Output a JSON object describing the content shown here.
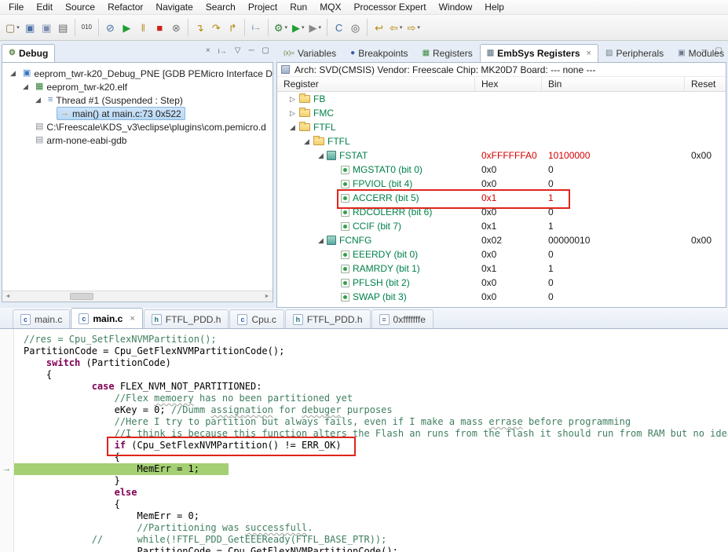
{
  "colors": {
    "annotation_red": "#e0241c",
    "changed_value_red": "#d40000",
    "register_name_green": "#00804a",
    "comment_green": "#3f7f5f",
    "keyword_purple": "#7f0055",
    "current_line_green": "#a4cf73",
    "selection_blue": "#cfe4fa"
  },
  "menu_bar": {
    "items": [
      "File",
      "Edit",
      "Source",
      "Refactor",
      "Navigate",
      "Search",
      "Project",
      "Run",
      "MQX",
      "Processor Expert",
      "Window",
      "Help"
    ]
  },
  "toolbar": {
    "items": [
      {
        "name": "new-wizard",
        "glyph": "▢",
        "color": "#8a7340",
        "dropdown": true
      },
      {
        "name": "save",
        "glyph": "▣",
        "color": "#4a6fa5"
      },
      {
        "name": "save-all",
        "glyph": "▣",
        "color": "#7a8db0"
      },
      {
        "name": "print",
        "glyph": "▤",
        "color": "#666666"
      },
      {
        "sep": true
      },
      {
        "name": "debug-binary",
        "glyph": "010",
        "color": "#333333"
      },
      {
        "sep": true
      },
      {
        "name": "skip-all-breakpoints",
        "glyph": "⊘",
        "color": "#3a6ea5"
      },
      {
        "name": "resume",
        "glyph": "▶",
        "color": "#1e9e33"
      },
      {
        "name": "suspend",
        "glyph": "‖",
        "color": "#b98f2f"
      },
      {
        "name": "terminate",
        "glyph": "■",
        "color": "#cf2219"
      },
      {
        "name": "disconnect",
        "glyph": "⊗",
        "color": "#777777"
      },
      {
        "sep": true
      },
      {
        "name": "step-into",
        "glyph": "↴",
        "color": "#b8860b"
      },
      {
        "name": "step-over",
        "glyph": "↷",
        "color": "#b8860b"
      },
      {
        "name": "step-return",
        "glyph": "↱",
        "color": "#b8860b"
      },
      {
        "sep": true
      },
      {
        "name": "instruction-stepping",
        "glyph": "i→",
        "color": "#3a6ea5"
      },
      {
        "sep": true
      },
      {
        "name": "debug",
        "glyph": "⚙",
        "color": "#2e7d32",
        "dropdown": true
      },
      {
        "name": "run",
        "glyph": "▶",
        "color": "#1e9e33",
        "dropdown": true
      },
      {
        "name": "external-tools",
        "glyph": "▶",
        "color": "#888888",
        "dropdown": true
      },
      {
        "sep": true
      },
      {
        "name": "new-c-project",
        "glyph": "C",
        "color": "#3a6ea5"
      },
      {
        "name": "search",
        "glyph": "◎",
        "color": "#555555"
      },
      {
        "sep": true
      },
      {
        "name": "last-edit-location",
        "glyph": "↩",
        "color": "#b8860b"
      },
      {
        "name": "back",
        "glyph": "⇦",
        "color": "#b8860b",
        "dropdown": true
      },
      {
        "name": "forward",
        "glyph": "⇨",
        "color": "#b8860b",
        "dropdown": true
      }
    ]
  },
  "debug_panel": {
    "tab_label": "Debug",
    "toolbar": [
      {
        "name": "remove-all-terminated",
        "glyph": "×"
      },
      {
        "name": "instruction-stepping-mode",
        "glyph": "i→"
      },
      {
        "name": "view-menu",
        "glyph": "▽"
      },
      {
        "name": "minimize",
        "glyph": "─"
      },
      {
        "name": "maximize",
        "glyph": "▢"
      }
    ],
    "tree": [
      {
        "label": "eeprom_twr-k20_Debug_PNE [GDB PEMicro Interface De",
        "level": 0,
        "icon": "debug-launch",
        "expander": "expanded"
      },
      {
        "label": "eeprom_twr-k20.elf",
        "level": 1,
        "icon": "executable",
        "expander": "expanded"
      },
      {
        "label": "Thread #1 (Suspended : Step)",
        "level": 2,
        "icon": "thread",
        "expander": "expanded"
      },
      {
        "label": "main() at main.c:73 0x522",
        "level": 3,
        "icon": "stack-frame",
        "selected": true
      },
      {
        "label": "C:\\Freescale\\KDS_v3\\eclipse\\plugins\\com.pemicro.d",
        "level": 1,
        "icon": "process"
      },
      {
        "label": "arm-none-eabi-gdb",
        "level": 1,
        "icon": "process"
      }
    ]
  },
  "registers_panel": {
    "tabs": [
      {
        "label": "Variables",
        "icon": "variables",
        "active": false
      },
      {
        "label": "Breakpoints",
        "icon": "breakpoints",
        "active": false
      },
      {
        "label": "Registers",
        "icon": "registers",
        "active": false
      },
      {
        "label": "EmbSys Registers",
        "icon": "embsys",
        "active": true
      },
      {
        "label": "Peripherals",
        "icon": "peripherals",
        "active": false
      },
      {
        "label": "Modules",
        "icon": "modules",
        "active": false
      }
    ],
    "toolbar": [
      {
        "name": "minimize",
        "glyph": "─"
      },
      {
        "name": "maximize",
        "glyph": "▢"
      }
    ],
    "info_line": "Arch: SVD(CMSIS)  Vendor: Freescale  Chip: MK20D7  Board: ---  none ---",
    "columns": [
      "Register",
      "Hex",
      "Bin",
      "Reset"
    ],
    "rows": [
      {
        "name": "FB",
        "level": 0,
        "type": "folder",
        "expander": "collapsed"
      },
      {
        "name": "FMC",
        "level": 0,
        "type": "folder",
        "expander": "collapsed"
      },
      {
        "name": "FTFL",
        "level": 0,
        "type": "folder",
        "expander": "expanded"
      },
      {
        "name": "FTFL",
        "level": 1,
        "type": "folder",
        "expander": "expanded"
      },
      {
        "name": "FSTAT",
        "level": 2,
        "type": "register",
        "expander": "expanded",
        "hex": "0xFFFFFFA0",
        "bin": "10100000",
        "reset": "0x00",
        "changed": true
      },
      {
        "name": "MGSTAT0 (bit 0)",
        "level": 3,
        "type": "bit",
        "hex": "0x0",
        "bin": "0"
      },
      {
        "name": "FPVIOL (bit 4)",
        "level": 3,
        "type": "bit",
        "hex": "0x0",
        "bin": "0"
      },
      {
        "name": "ACCERR (bit 5)",
        "level": 3,
        "type": "bit",
        "hex": "0x1",
        "bin": "1",
        "changed": true
      },
      {
        "name": "RDCOLERR (bit 6)",
        "level": 3,
        "type": "bit",
        "hex": "0x0",
        "bin": "0"
      },
      {
        "name": "CCIF (bit 7)",
        "level": 3,
        "type": "bit",
        "hex": "0x1",
        "bin": "1"
      },
      {
        "name": "FCNFG",
        "level": 2,
        "type": "register",
        "expander": "expanded",
        "hex": "0x02",
        "bin": "00000010",
        "reset": "0x00"
      },
      {
        "name": "EEERDY (bit 0)",
        "level": 3,
        "type": "bit",
        "hex": "0x0",
        "bin": "0"
      },
      {
        "name": "RAMRDY (bit 1)",
        "level": 3,
        "type": "bit",
        "hex": "0x1",
        "bin": "1"
      },
      {
        "name": "PFLSH (bit 2)",
        "level": 3,
        "type": "bit",
        "hex": "0x0",
        "bin": "0"
      },
      {
        "name": "SWAP (bit 3)",
        "level": 3,
        "type": "bit",
        "hex": "0x0",
        "bin": "0"
      }
    ]
  },
  "editor_panel": {
    "tabs": [
      {
        "label": "main.c",
        "icon": "c",
        "active": false
      },
      {
        "label": "main.c",
        "icon": "c",
        "active": true
      },
      {
        "label": "FTFL_PDD.h",
        "icon": "h",
        "active": false
      },
      {
        "label": "Cpu.c",
        "icon": "c",
        "active": false
      },
      {
        "label": "FTFL_PDD.h",
        "icon": "h",
        "active": false
      },
      {
        "label": "0xfffffffe",
        "icon": "asm",
        "active": false
      }
    ],
    "code_lines": [
      {
        "indent": 0,
        "segments": [
          [
            "c",
            "//res = Cpu_SetFlexNVMPartition();"
          ]
        ]
      },
      {
        "indent": 0,
        "segments": [
          [
            "p",
            "PartitionCode = Cpu_GetFlexNVMPartitionCode();"
          ]
        ]
      },
      {
        "indent": 4,
        "segments": [
          [
            "k",
            "switch"
          ],
          [
            "p",
            " (PartitionCode)"
          ]
        ]
      },
      {
        "indent": 4,
        "segments": [
          [
            "p",
            "{"
          ]
        ]
      },
      {
        "indent": 12,
        "segments": [
          [
            "k",
            "case"
          ],
          [
            "p",
            " FLEX_NVM_NOT_PARTITIONED:"
          ]
        ]
      },
      {
        "indent": 16,
        "segments": [
          [
            "c",
            "//Flex "
          ],
          [
            "cs",
            "memoery"
          ],
          [
            "c",
            " has no been partitioned yet"
          ]
        ]
      },
      {
        "indent": 16,
        "segments": [
          [
            "p",
            "eKey = 0; "
          ],
          [
            "c",
            "//Dumm "
          ],
          [
            "cs",
            "assignation"
          ],
          [
            "c",
            " for "
          ],
          [
            "cs",
            "debuger"
          ],
          [
            "c",
            " purposes"
          ]
        ]
      },
      {
        "indent": 16,
        "segments": [
          [
            "c",
            "//Here I try to partition but always fails, even if I make a mass "
          ],
          [
            "cs",
            "errase"
          ],
          [
            "c",
            " before programming"
          ]
        ]
      },
      {
        "indent": 16,
        "segments": [
          [
            "c",
            "//I think is because this function alters the Flash an runs from the flash it should run from RAM but no idea how"
          ]
        ]
      },
      {
        "indent": 16,
        "segments": [
          [
            "k",
            "if"
          ],
          [
            "p",
            " (Cpu_SetFlexNVMPartition() != ERR_OK)"
          ]
        ]
      },
      {
        "indent": 16,
        "segments": [
          [
            "p",
            "{"
          ]
        ]
      },
      {
        "indent": 20,
        "segments": [
          [
            "p",
            "MemErr = 1;"
          ]
        ],
        "current": true
      },
      {
        "indent": 16,
        "segments": [
          [
            "p",
            "}"
          ]
        ]
      },
      {
        "indent": 16,
        "segments": [
          [
            "k",
            "else"
          ]
        ]
      },
      {
        "indent": 16,
        "segments": [
          [
            "p",
            "{"
          ]
        ]
      },
      {
        "indent": 20,
        "segments": [
          [
            "p",
            "MemErr = 0;"
          ]
        ]
      },
      {
        "indent": 20,
        "segments": [
          [
            "c",
            "//Partitioning was "
          ],
          [
            "cs",
            "successfull"
          ],
          [
            "c",
            "."
          ]
        ]
      },
      {
        "indent": 12,
        "segments": [
          [
            "c",
            "//      while(!FTFL_PDD_GetEEEReady(FTFL_BASE_PTR));"
          ]
        ]
      },
      {
        "indent": 20,
        "segments": [
          [
            "p",
            "PartitionCode = Cpu_GetFlexNVMPartitionCode();"
          ]
        ]
      }
    ]
  }
}
